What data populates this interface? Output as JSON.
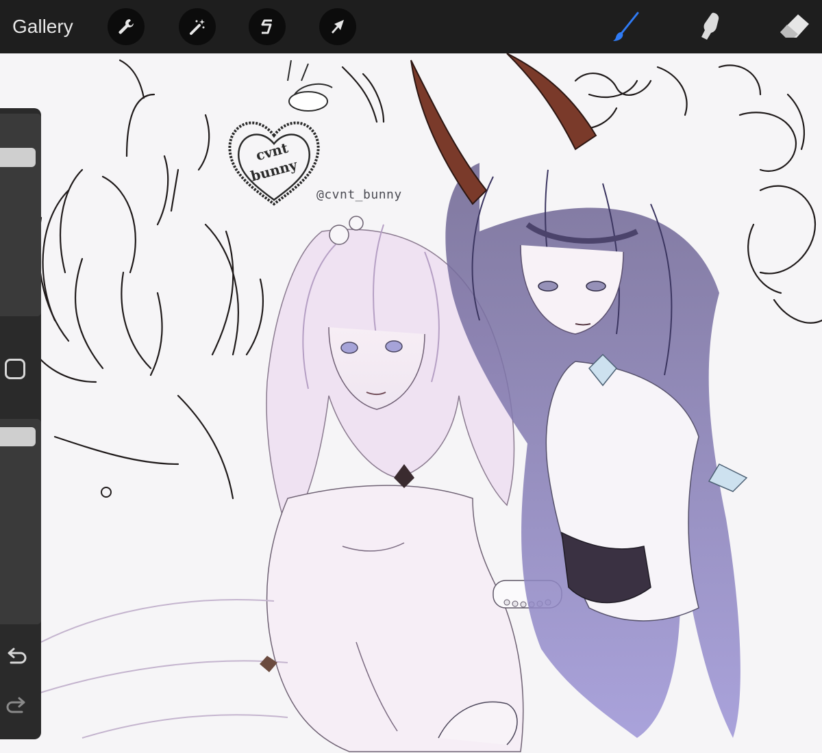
{
  "toolbar": {
    "gallery_label": "Gallery",
    "left_tools": [
      {
        "name": "actions",
        "icon": "wrench-icon"
      },
      {
        "name": "adjustments",
        "icon": "magic-wand-icon"
      },
      {
        "name": "selection",
        "icon": "selection-s-icon"
      },
      {
        "name": "transform",
        "icon": "arrow-cursor-icon"
      }
    ],
    "right_tools": [
      {
        "name": "paint",
        "icon": "brush-icon",
        "active": true
      },
      {
        "name": "smudge",
        "icon": "smudge-finger-icon",
        "active": false
      },
      {
        "name": "erase",
        "icon": "eraser-icon",
        "active": false
      }
    ],
    "active_color": "#2f7bf5"
  },
  "canvas": {
    "watermark_text": "@cvnt_bunny",
    "logo_text": "cvnt bunny"
  },
  "sidebar": {
    "brush_size_level": 0.05,
    "opacity_level": 0.05,
    "icons": [
      "modify-square-icon",
      "undo-icon",
      "redo-icon"
    ]
  }
}
